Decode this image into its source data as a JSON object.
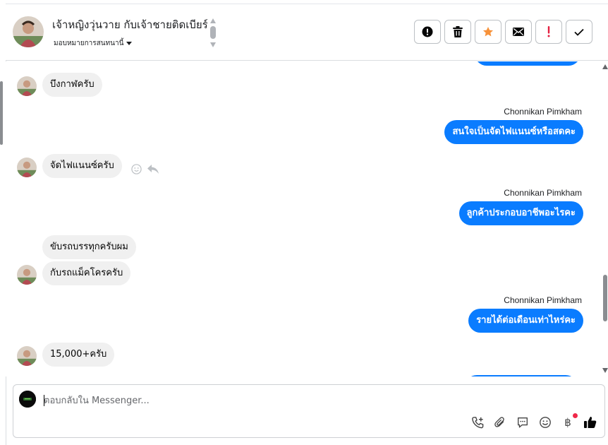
{
  "header": {
    "contact_name": "เจ้าหญิงวุ่นวาย กับเจ้าชายติดเบียร์",
    "assign_label": "มอบหมายการสนทนานี้",
    "actions": [
      {
        "name": "report-icon",
        "color": "#050505"
      },
      {
        "name": "trash-icon",
        "color": "#050505"
      },
      {
        "name": "star-icon",
        "color": "#f7923a"
      },
      {
        "name": "mail-icon",
        "color": "#050505"
      },
      {
        "name": "exclamation-icon",
        "color": "#e41e3f"
      },
      {
        "name": "check-icon",
        "color": "#050505"
      }
    ]
  },
  "messages": {
    "m1": {
      "text": "บึงกาฬครับ"
    },
    "m2": {
      "sender": "Chonnikan Pimkham",
      "text": "สนใจเป็นจัดไฟแนนซ์หรือสดคะ"
    },
    "m3": {
      "text": "จัดไฟแนนซ์ครับ"
    },
    "m4": {
      "sender": "Chonnikan Pimkham",
      "text": "ลูกค้าประกอบอาชีพอะไรคะ"
    },
    "m5": {
      "text": "ขับรถบรรทุกครับผม"
    },
    "m6": {
      "text": "กับรถแม็คโครครับ"
    },
    "m7": {
      "sender": "Chonnikan Pimkham",
      "text": "รายได้ต่อเดือนเท่าไหร่คะ"
    },
    "m8": {
      "text": "15,000+ครับ"
    }
  },
  "composer": {
    "placeholder": "ตอบกลับใน Messenger...",
    "tools": [
      "phone-plus-icon",
      "paperclip-icon",
      "saved-reply-icon",
      "emoji-icon",
      "baht-icon",
      "like-icon"
    ],
    "baht_symbol": "฿"
  },
  "colors": {
    "outgoing_bubble": "#0a7cff",
    "incoming_bubble": "#f0f0f0"
  }
}
